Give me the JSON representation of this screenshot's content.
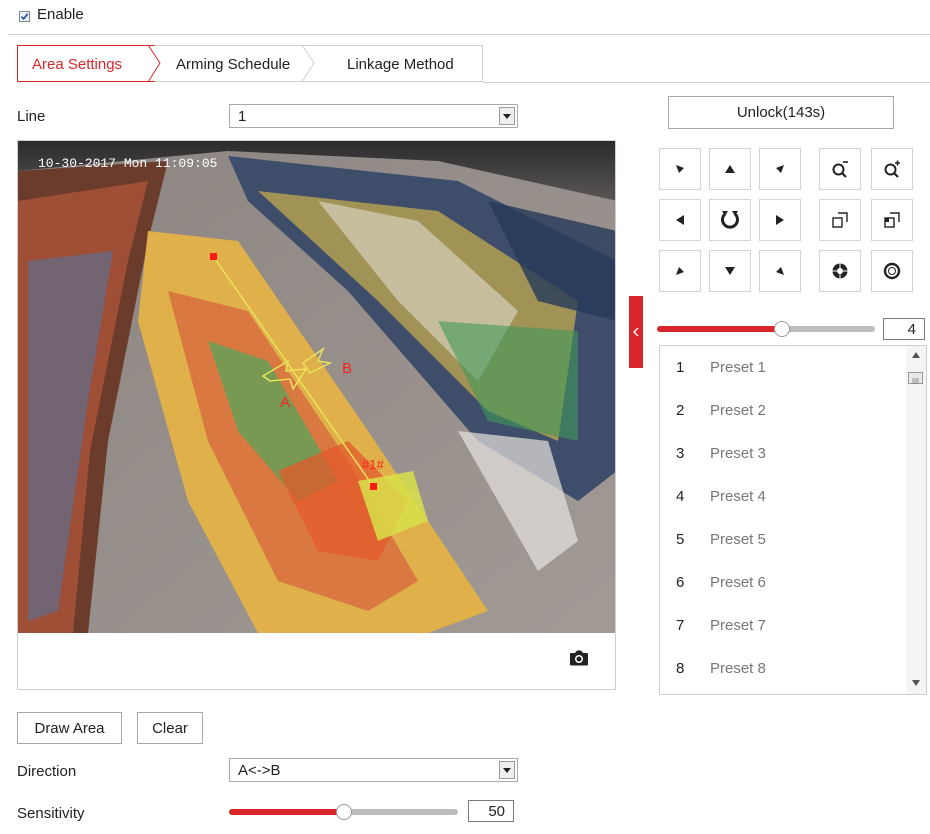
{
  "enable": {
    "label": "Enable",
    "checked": true
  },
  "tabs": [
    {
      "label": "Area Settings",
      "active": true
    },
    {
      "label": "Arming Schedule",
      "active": false
    },
    {
      "label": "Linkage Method",
      "active": false
    }
  ],
  "line": {
    "label": "Line",
    "value": "1"
  },
  "video": {
    "timestamp": "10-30-2017 Mon 11:09:05",
    "rule_point_a": "A",
    "rule_point_b": "B",
    "rule_id": "#1#",
    "snapshot_icon": "camera-icon"
  },
  "ptz": {
    "unlock_label": "Unlock(143s)",
    "speed_value": "4",
    "speed_level": 4,
    "speed_max": 7,
    "icons": [
      "arrow-up-left-icon",
      "arrow-up-icon",
      "arrow-up-right-icon",
      "zoom-out-icon",
      "zoom-in-icon",
      "arrow-left-icon",
      "auto-pan-icon",
      "arrow-right-icon",
      "focus-near-icon",
      "focus-far-icon",
      "arrow-down-left-icon",
      "arrow-down-icon",
      "arrow-down-right-icon",
      "iris-close-icon",
      "iris-open-icon"
    ]
  },
  "presets": [
    {
      "num": "1",
      "name": "Preset 1"
    },
    {
      "num": "2",
      "name": "Preset 2"
    },
    {
      "num": "3",
      "name": "Preset 3"
    },
    {
      "num": "4",
      "name": "Preset 4"
    },
    {
      "num": "5",
      "name": "Preset 5"
    },
    {
      "num": "6",
      "name": "Preset 6"
    },
    {
      "num": "7",
      "name": "Preset 7"
    },
    {
      "num": "8",
      "name": "Preset 8"
    }
  ],
  "buttons": {
    "draw_area": "Draw Area",
    "clear": "Clear"
  },
  "direction": {
    "label": "Direction",
    "value": "A<->B"
  },
  "sensitivity": {
    "label": "Sensitivity",
    "value": "50",
    "level": 50,
    "max": 100
  },
  "colors": {
    "accent": "#d8262b",
    "border": "#cfcfcf",
    "muted_text": "#777777"
  }
}
